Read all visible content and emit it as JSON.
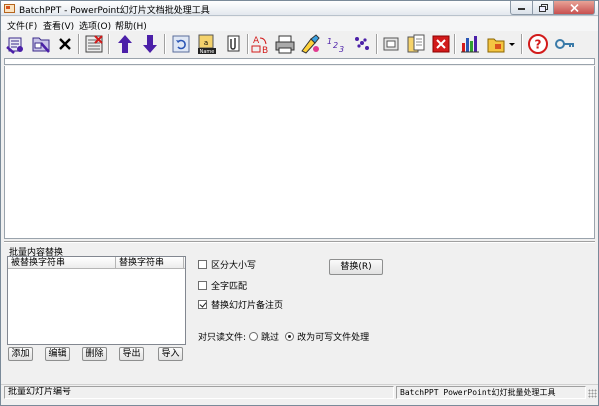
{
  "window": {
    "title": "BatchPPT - PowerPoint幻灯片文档批处理工具"
  },
  "menu": [
    "文件(F)",
    "查看(V)",
    "选项(O)",
    "帮助(H)"
  ],
  "toolbar": {
    "buttons": [
      "add-files-icon",
      "add-folder-icon",
      "remove-icon",
      "clear-list-icon",
      "move-up-icon",
      "move-down-icon",
      "refresh-icon",
      "rename-icon",
      "copy-icon",
      "replace-text-icon",
      "print-icon",
      "paint-icon",
      "numbering-icon",
      "dots-icon",
      "slide-icon",
      "notes-icon",
      "delete-icon",
      "chart-icon",
      "folder-options-icon",
      "help-icon",
      "key-icon"
    ]
  },
  "replace_panel": {
    "title": "批量内容替换",
    "columns": [
      "被替换字符串",
      "替换字符串"
    ],
    "buttons": {
      "add": "添加",
      "edit": "编辑",
      "delete": "删除",
      "export": "导出",
      "import": "导入"
    },
    "options": {
      "case_sensitive": {
        "label": "区分大小写",
        "checked": false
      },
      "whole_word": {
        "label": "全字匹配",
        "checked": false
      },
      "replace_notes": {
        "label": "替换幻灯片备注页",
        "checked": true
      }
    },
    "replace_button": "替换(R)",
    "readonly": {
      "label": "对只读文件:",
      "skip": {
        "label": "跳过",
        "checked": false
      },
      "writable": {
        "label": "改为可写文件处理",
        "checked": true
      }
    }
  },
  "status": {
    "left": "批量幻灯片编号",
    "right": "BatchPPT PowerPoint幻灯批量处理工具"
  },
  "colors": {
    "accent_purple": "#4b1fa8",
    "help_red": "#d21a1a",
    "close_red": "#c75050"
  }
}
